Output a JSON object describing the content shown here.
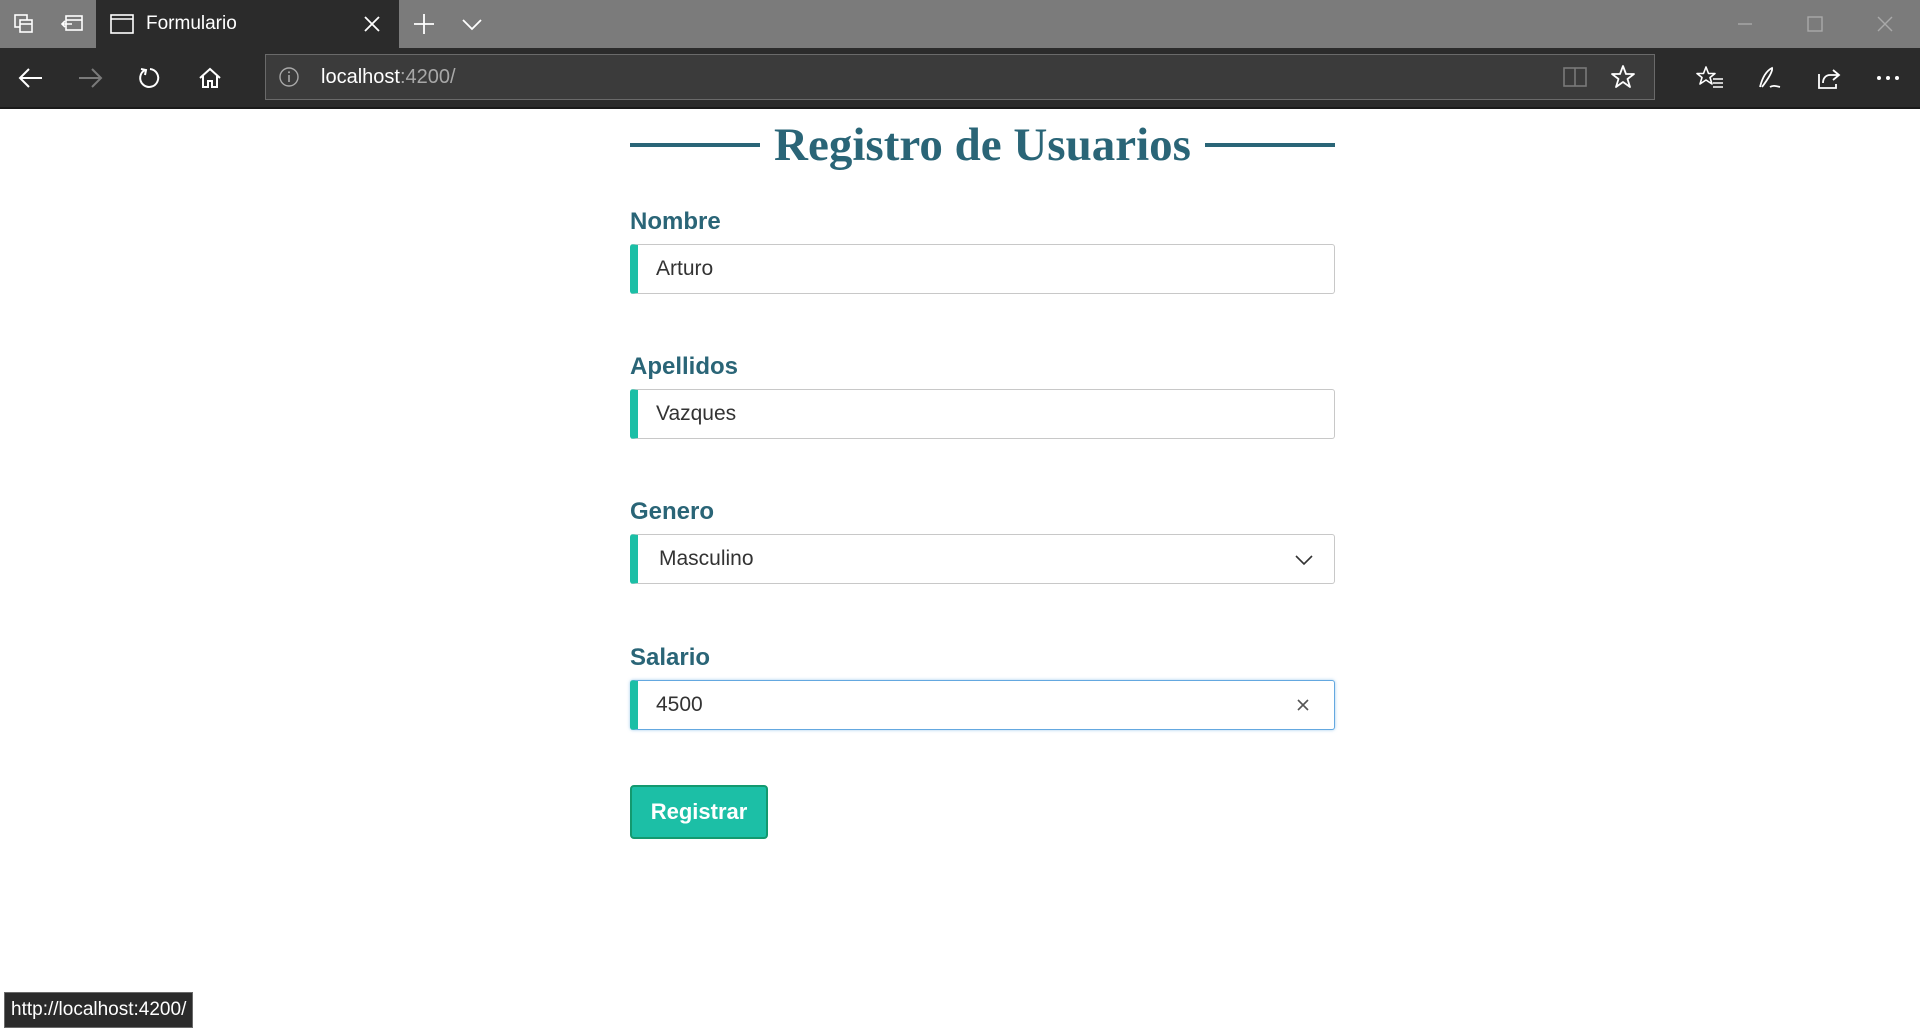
{
  "browser": {
    "tab_title": "Formulario",
    "url_host": "localhost",
    "url_path": ":4200/",
    "status_url": "http://localhost:4200/"
  },
  "form": {
    "title": "Registro de Usuarios",
    "fields": [
      {
        "label": "Nombre",
        "value": "Arturo",
        "type": "text"
      },
      {
        "label": "Apellidos",
        "value": "Vazques",
        "type": "text"
      },
      {
        "label": "Genero",
        "value": "Masculino",
        "type": "select"
      },
      {
        "label": "Salario",
        "value": "4500",
        "type": "number"
      }
    ],
    "submit_label": "Registrar"
  },
  "colors": {
    "accent": "#1cbfa6",
    "heading": "#2a6577",
    "chrome": "#2b2b2b"
  },
  "icons": [
    "tab-manager-icon",
    "set-aside-tabs-icon",
    "tab-page-icon",
    "close-icon",
    "new-tab-icon",
    "chevron-down-icon",
    "back-icon",
    "forward-icon",
    "refresh-icon",
    "home-icon",
    "info-icon",
    "reading-view-icon",
    "favorite-star-icon",
    "favorites-hub-icon",
    "pen-icon",
    "share-icon",
    "more-icon"
  ]
}
